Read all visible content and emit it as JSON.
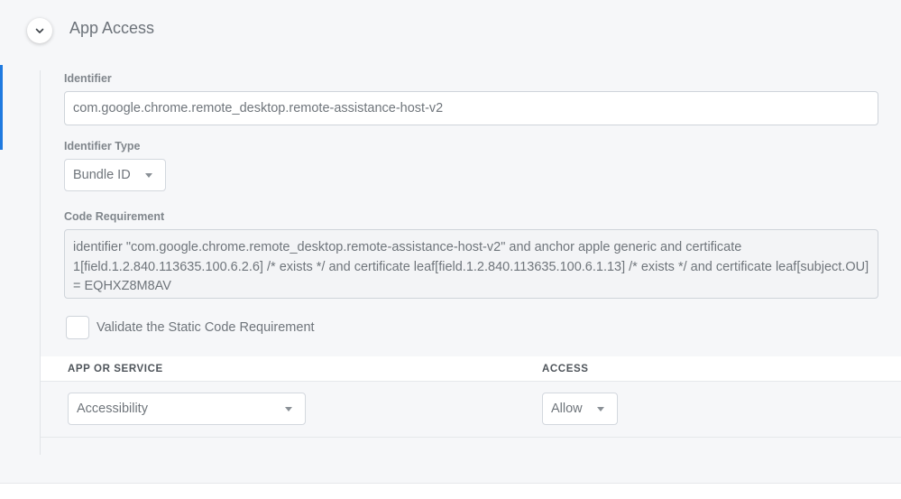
{
  "section": {
    "title": "App Access",
    "collapse_icon": "chevron-down-icon"
  },
  "identifier": {
    "label": "Identifier",
    "value": "com.google.chrome.remote_desktop.remote-assistance-host-v2"
  },
  "identifier_type": {
    "label": "Identifier Type",
    "selected": "Bundle ID"
  },
  "code_requirement": {
    "label": "Code Requirement",
    "value": "identifier \"com.google.chrome.remote_desktop.remote-assistance-host-v2\" and anchor apple generic and certificate 1[field.1.2.840.113635.100.6.2.6] /* exists */ and certificate leaf[field.1.2.840.113635.100.6.1.13] /* exists */ and certificate leaf[subject.OU] = EQHXZ8M8AV"
  },
  "validate_static": {
    "label": "Validate the Static Code Requirement",
    "checked": false
  },
  "table": {
    "columns": [
      "APP OR SERVICE",
      "ACCESS"
    ],
    "rows": [
      {
        "service": "Accessibility",
        "access": "Allow"
      }
    ]
  },
  "colors": {
    "accent": "#1f7ae0",
    "background": "#f6f7f9"
  }
}
